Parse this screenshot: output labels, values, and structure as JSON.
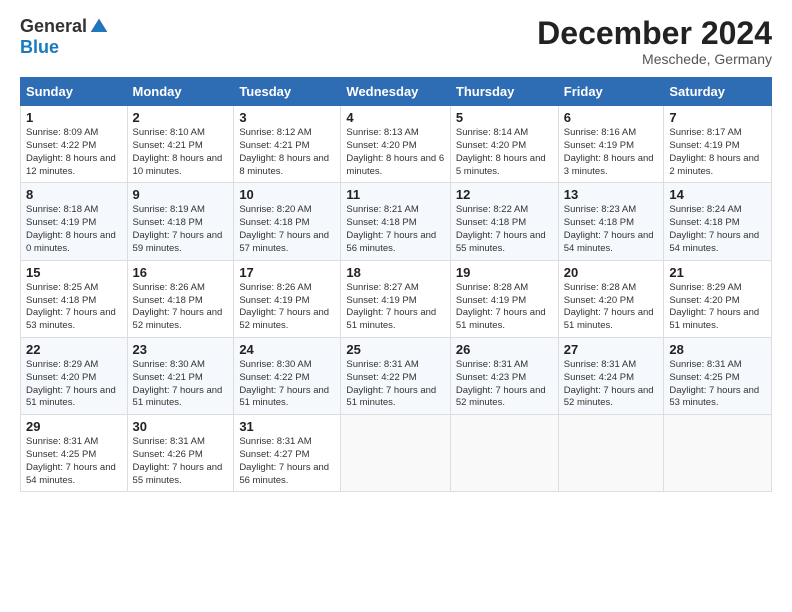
{
  "header": {
    "logo_general": "General",
    "logo_blue": "Blue",
    "month_title": "December 2024",
    "location": "Meschede, Germany"
  },
  "days_of_week": [
    "Sunday",
    "Monday",
    "Tuesday",
    "Wednesday",
    "Thursday",
    "Friday",
    "Saturday"
  ],
  "weeks": [
    [
      {
        "day": "1",
        "sunrise": "8:09 AM",
        "sunset": "4:22 PM",
        "daylight": "8 hours and 12 minutes."
      },
      {
        "day": "2",
        "sunrise": "8:10 AM",
        "sunset": "4:21 PM",
        "daylight": "8 hours and 10 minutes."
      },
      {
        "day": "3",
        "sunrise": "8:12 AM",
        "sunset": "4:21 PM",
        "daylight": "8 hours and 8 minutes."
      },
      {
        "day": "4",
        "sunrise": "8:13 AM",
        "sunset": "4:20 PM",
        "daylight": "8 hours and 6 minutes."
      },
      {
        "day": "5",
        "sunrise": "8:14 AM",
        "sunset": "4:20 PM",
        "daylight": "8 hours and 5 minutes."
      },
      {
        "day": "6",
        "sunrise": "8:16 AM",
        "sunset": "4:19 PM",
        "daylight": "8 hours and 3 minutes."
      },
      {
        "day": "7",
        "sunrise": "8:17 AM",
        "sunset": "4:19 PM",
        "daylight": "8 hours and 2 minutes."
      }
    ],
    [
      {
        "day": "8",
        "sunrise": "8:18 AM",
        "sunset": "4:19 PM",
        "daylight": "8 hours and 0 minutes."
      },
      {
        "day": "9",
        "sunrise": "8:19 AM",
        "sunset": "4:18 PM",
        "daylight": "7 hours and 59 minutes."
      },
      {
        "day": "10",
        "sunrise": "8:20 AM",
        "sunset": "4:18 PM",
        "daylight": "7 hours and 57 minutes."
      },
      {
        "day": "11",
        "sunrise": "8:21 AM",
        "sunset": "4:18 PM",
        "daylight": "7 hours and 56 minutes."
      },
      {
        "day": "12",
        "sunrise": "8:22 AM",
        "sunset": "4:18 PM",
        "daylight": "7 hours and 55 minutes."
      },
      {
        "day": "13",
        "sunrise": "8:23 AM",
        "sunset": "4:18 PM",
        "daylight": "7 hours and 54 minutes."
      },
      {
        "day": "14",
        "sunrise": "8:24 AM",
        "sunset": "4:18 PM",
        "daylight": "7 hours and 54 minutes."
      }
    ],
    [
      {
        "day": "15",
        "sunrise": "8:25 AM",
        "sunset": "4:18 PM",
        "daylight": "7 hours and 53 minutes."
      },
      {
        "day": "16",
        "sunrise": "8:26 AM",
        "sunset": "4:18 PM",
        "daylight": "7 hours and 52 minutes."
      },
      {
        "day": "17",
        "sunrise": "8:26 AM",
        "sunset": "4:19 PM",
        "daylight": "7 hours and 52 minutes."
      },
      {
        "day": "18",
        "sunrise": "8:27 AM",
        "sunset": "4:19 PM",
        "daylight": "7 hours and 51 minutes."
      },
      {
        "day": "19",
        "sunrise": "8:28 AM",
        "sunset": "4:19 PM",
        "daylight": "7 hours and 51 minutes."
      },
      {
        "day": "20",
        "sunrise": "8:28 AM",
        "sunset": "4:20 PM",
        "daylight": "7 hours and 51 minutes."
      },
      {
        "day": "21",
        "sunrise": "8:29 AM",
        "sunset": "4:20 PM",
        "daylight": "7 hours and 51 minutes."
      }
    ],
    [
      {
        "day": "22",
        "sunrise": "8:29 AM",
        "sunset": "4:20 PM",
        "daylight": "7 hours and 51 minutes."
      },
      {
        "day": "23",
        "sunrise": "8:30 AM",
        "sunset": "4:21 PM",
        "daylight": "7 hours and 51 minutes."
      },
      {
        "day": "24",
        "sunrise": "8:30 AM",
        "sunset": "4:22 PM",
        "daylight": "7 hours and 51 minutes."
      },
      {
        "day": "25",
        "sunrise": "8:31 AM",
        "sunset": "4:22 PM",
        "daylight": "7 hours and 51 minutes."
      },
      {
        "day": "26",
        "sunrise": "8:31 AM",
        "sunset": "4:23 PM",
        "daylight": "7 hours and 52 minutes."
      },
      {
        "day": "27",
        "sunrise": "8:31 AM",
        "sunset": "4:24 PM",
        "daylight": "7 hours and 52 minutes."
      },
      {
        "day": "28",
        "sunrise": "8:31 AM",
        "sunset": "4:25 PM",
        "daylight": "7 hours and 53 minutes."
      }
    ],
    [
      {
        "day": "29",
        "sunrise": "8:31 AM",
        "sunset": "4:25 PM",
        "daylight": "7 hours and 54 minutes."
      },
      {
        "day": "30",
        "sunrise": "8:31 AM",
        "sunset": "4:26 PM",
        "daylight": "7 hours and 55 minutes."
      },
      {
        "day": "31",
        "sunrise": "8:31 AM",
        "sunset": "4:27 PM",
        "daylight": "7 hours and 56 minutes."
      },
      null,
      null,
      null,
      null
    ]
  ]
}
